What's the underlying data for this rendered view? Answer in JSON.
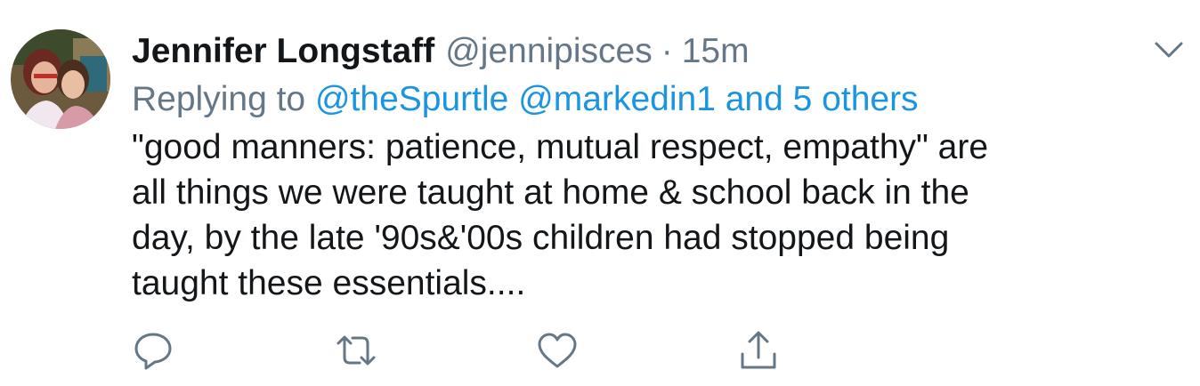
{
  "tweet": {
    "author_name": "Jennifer Longstaff",
    "author_handle": "@jennipisces",
    "separator": "·",
    "timestamp": "15m",
    "reply_prefix": "Replying to",
    "reply_to": [
      "@theSpurtle",
      "@markedin1",
      "and 5 others"
    ],
    "text_lines": [
      "\"good manners:  patience, mutual respect, empathy\" are",
      "all things we were taught at home & school back in the",
      "day, by the late '90s&'00s children had stopped being",
      "taught these essentials...."
    ]
  },
  "icons": {
    "menu": "chevron-down-icon",
    "reply": "reply-icon",
    "retweet": "retweet-icon",
    "like": "heart-icon",
    "share": "share-icon"
  },
  "colors": {
    "text": "#14171a",
    "secondary": "#657786",
    "link": "#1b95e0",
    "background": "#ffffff"
  }
}
